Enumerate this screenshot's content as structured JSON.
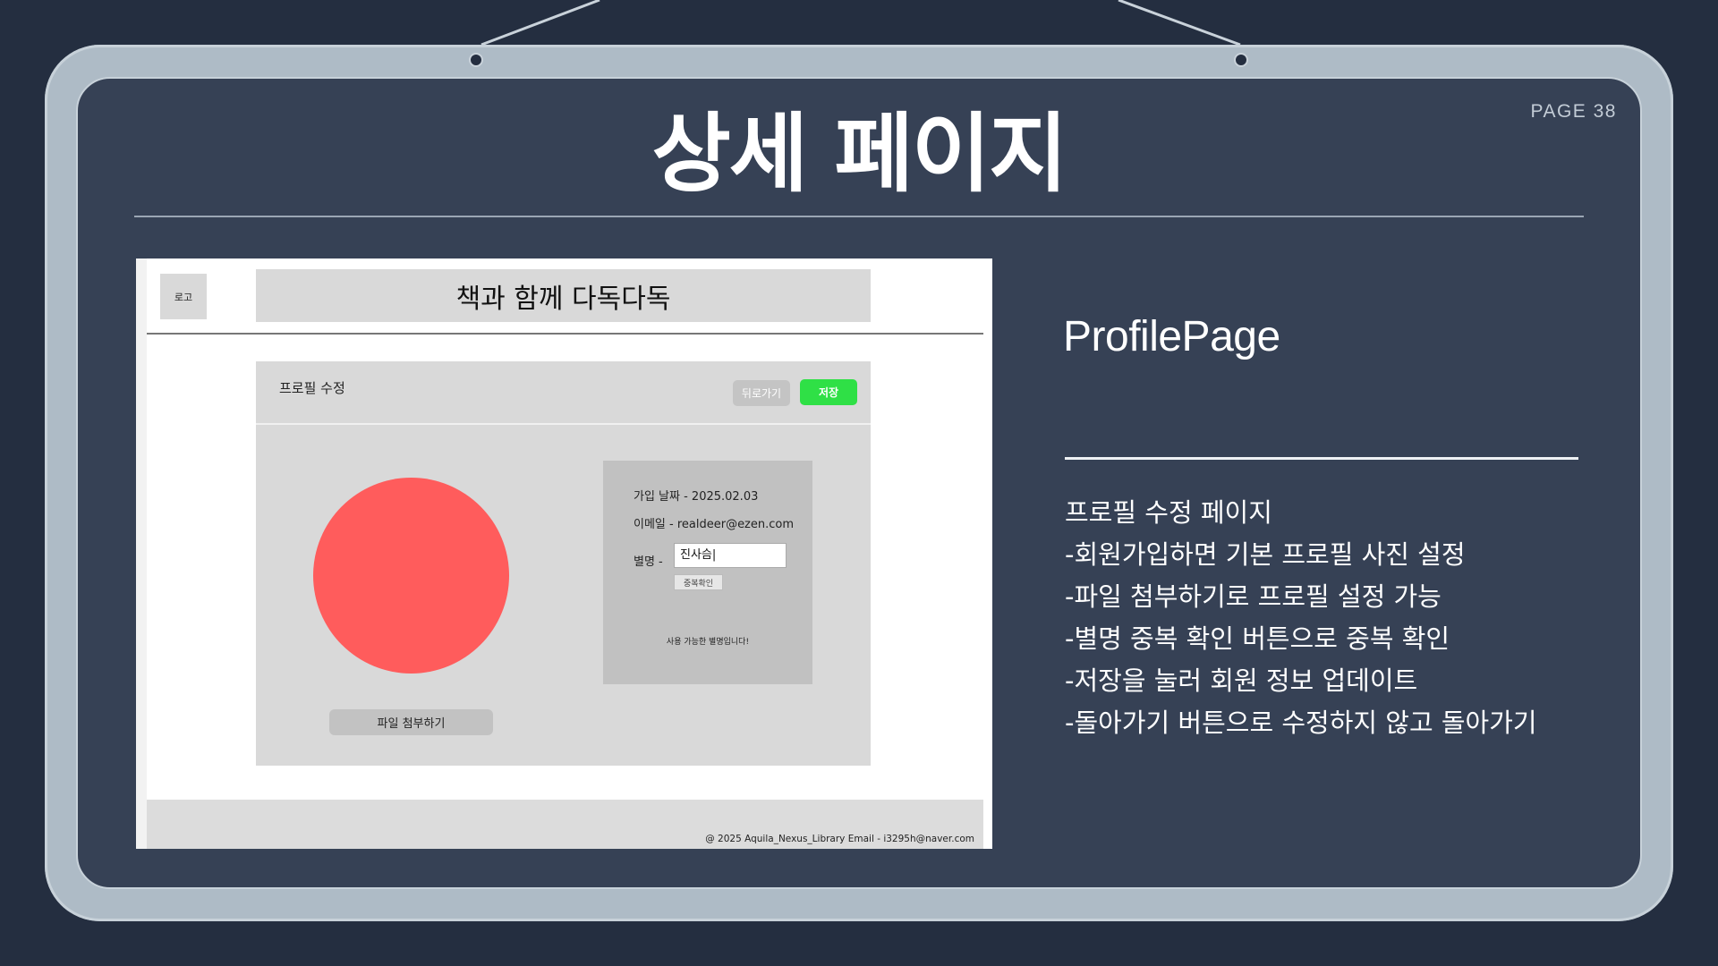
{
  "page": {
    "page_number": "PAGE 38",
    "title": "상세 페이지"
  },
  "mockup": {
    "logo": "로고",
    "header_title": "책과 함께 다독다독",
    "panel_title": "프로필 수정",
    "back_button": "뒤로가기",
    "save_button": "저장",
    "attach_button": "파일 첨부하기",
    "join_date": "가입 날짜 - 2025.02.03",
    "email": "이메일 - realdeer@ezen.com",
    "nickname_label": "별명 -",
    "nickname_value": "진사슴|",
    "duplicate_check_button": "중복확인",
    "available_message": "사용 가능한 별명입니다!",
    "footer": "@ 2025 Aquila_Nexus_Library   Email - i3295h@naver.com",
    "colors": {
      "save_green": "#2fe046",
      "avatar_red": "#ff5c5c"
    }
  },
  "description": {
    "heading": "ProfilePage",
    "lines": [
      "프로필 수정 페이지",
      "-회원가입하면 기본 프로필 사진 설정",
      "-파일 첨부하기로 프로필 설정 가능",
      "-별명 중복 확인 버튼으로 중복 확인",
      "-저장을 눌러 회원 정보 업데이트",
      "-돌아가기 버튼으로 수정하지 않고 돌아가기"
    ]
  },
  "colors": {
    "background": "#242e40",
    "frame": "#aebbc6",
    "board": "#364155"
  }
}
